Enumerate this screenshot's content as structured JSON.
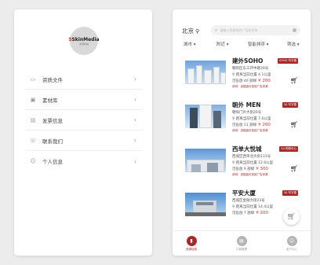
{
  "left_panel": {
    "logo": {
      "brand": "SkinMedia",
      "mark": "S",
      "subtext": "资源商城"
    },
    "menu": [
      {
        "label": "资质文件",
        "icon": "folder-icon"
      },
      {
        "label": "素材库",
        "icon": "media-icon"
      },
      {
        "label": "发票信息",
        "icon": "invoice-icon"
      },
      {
        "label": "联系我们",
        "icon": "phone-icon"
      },
      {
        "label": "个人信息",
        "icon": "user-icon"
      }
    ],
    "arrow": "›"
  },
  "right_panel": {
    "city": "北京",
    "search_placeholder": "请输入您想找的广告的名称",
    "filters": [
      "城市",
      "附近",
      "智能排序",
      "筛选"
    ],
    "listings": [
      {
        "name": "建外SOHO",
        "badge": "SOHO 写字楼",
        "address": "朝阳区东三环中路39号",
        "distance": "距离当前位置 4.1公里",
        "stock_text": "可投放 40 部梯",
        "price": "¥ 200",
        "note": "说明：该楼盘可投放广告资源"
      },
      {
        "name": "朝外 MEN",
        "badge": "5A 写字楼",
        "address": "朝阳门外大街26号",
        "distance": "距离当前位置 7.6公里",
        "stock_text": "可投放 11 部梯",
        "price": "¥ 200",
        "note": "说明：该楼盘可投放广告资源"
      },
      {
        "name": "西单大悦城",
        "badge": "5A 购物中心",
        "address": "西城区西单北大街131号",
        "distance": "距离当前位置 12.6公里",
        "stock_text": "可投放 9 部梯",
        "price": "¥ 300",
        "note": "说明：该楼盘可投放广告资源"
      },
      {
        "name": "平安大厦",
        "badge": "5A 写字楼",
        "address": "西城区金融大街23号",
        "distance": "距离当前位置 14.4公里",
        "stock_text": "可投放 7 部梯",
        "price": "¥ 200",
        "note": ""
      }
    ],
    "tabs": [
      {
        "label": "资源检索",
        "active": true,
        "icon": "building-icon"
      },
      {
        "label": "订单管理",
        "active": false,
        "icon": "order-icon"
      },
      {
        "label": "用户中心",
        "active": false,
        "icon": "user-icon"
      }
    ]
  },
  "colors": {
    "accent": "#c0392b",
    "badge": "#a52a2a"
  }
}
